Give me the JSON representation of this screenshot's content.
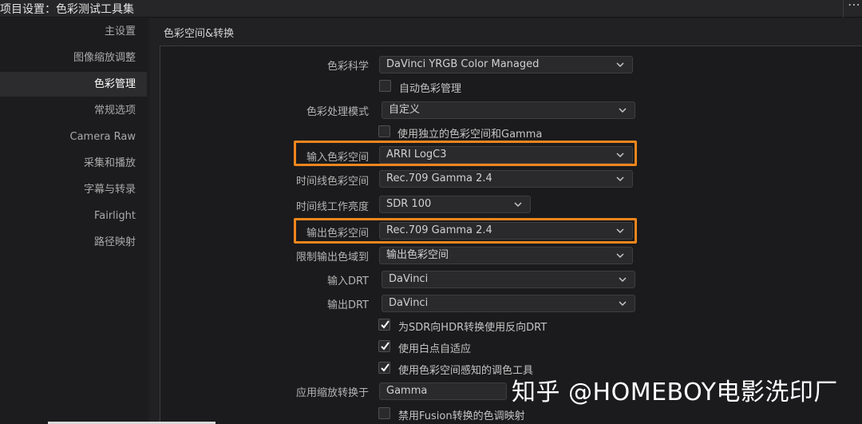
{
  "window": {
    "title": "项目设置：色彩测试工具集",
    "more_glyph": "⋯"
  },
  "sidebar": {
    "items": [
      {
        "label": "主设置",
        "active": false
      },
      {
        "label": "图像缩放调整",
        "active": false
      },
      {
        "label": "色彩管理",
        "active": true
      },
      {
        "label": "常规选项",
        "active": false
      },
      {
        "label": "Camera Raw",
        "active": false
      },
      {
        "label": "采集和播放",
        "active": false
      },
      {
        "label": "字幕与转录",
        "active": false
      },
      {
        "label": "Fairlight",
        "active": false
      },
      {
        "label": "路径映射",
        "active": false
      }
    ]
  },
  "section": {
    "title": "色彩空间&转换"
  },
  "form": {
    "color_science": {
      "label": "色彩科学",
      "value": "DaVinci YRGB Color Managed"
    },
    "auto_color_mgmt": {
      "label": "自动色彩管理",
      "checked": false
    },
    "color_processing_mode": {
      "label": "色彩处理模式",
      "value": "自定义"
    },
    "separate_color_space": {
      "label": "使用独立的色彩空间和Gamma",
      "checked": false
    },
    "input_color_space": {
      "label": "输入色彩空间",
      "value": "ARRI LogC3",
      "highlighted": true
    },
    "timeline_color_space": {
      "label": "时间线色彩空间",
      "value": "Rec.709 Gamma 2.4"
    },
    "timeline_working_luminance": {
      "label": "时间线工作亮度",
      "value": "SDR 100"
    },
    "output_color_space": {
      "label": "输出色彩空间",
      "value": "Rec.709 Gamma 2.4",
      "highlighted": true
    },
    "limit_output_gamut": {
      "label": "限制输出色域到",
      "value": "输出色彩空间"
    },
    "input_drt": {
      "label": "输入DRT",
      "value": "DaVinci"
    },
    "output_drt": {
      "label": "输出DRT",
      "value": "DaVinci"
    },
    "inverse_drt": {
      "label": "为SDR向HDR转换使用反向DRT",
      "checked": true
    },
    "white_point_adapt": {
      "label": "使用白点自适应",
      "checked": true
    },
    "color_aware_tools": {
      "label": "使用色彩空间感知的调色工具",
      "checked": true
    },
    "apply_resize_transform": {
      "label": "应用缩放转换于",
      "value": "Gamma"
    },
    "disable_fusion_tonemap": {
      "label": "禁用Fusion转换的色调映射",
      "checked": false
    }
  },
  "watermark": {
    "text": "知乎 @HOMEBOY电影洗印厂"
  },
  "colors": {
    "highlight": "#f0861c",
    "background": "#1e1e20",
    "active_item": "#2c2c2e"
  },
  "icons": {
    "dropdown": "chevron-down-icon",
    "check": "check-icon"
  }
}
